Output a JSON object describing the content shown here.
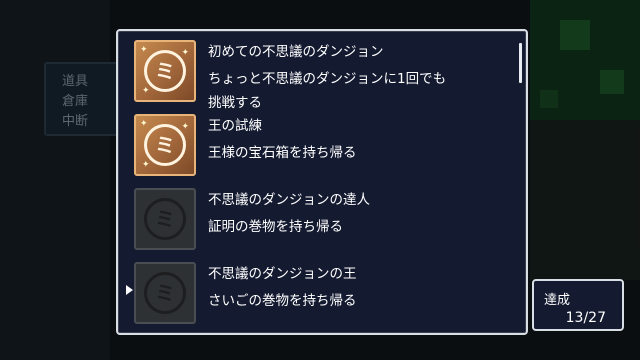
{
  "side_menu": {
    "items": [
      "道具",
      "倉庫",
      "中断"
    ]
  },
  "achievements": [
    {
      "title": "初めての不思議のダンジョン",
      "desc": "ちょっと不思議のダンジョンに1回でも挑戦する",
      "unlocked": true,
      "icon": "gold-medal-icon"
    },
    {
      "title": "王の試練",
      "desc": "王様の宝石箱を持ち帰る",
      "unlocked": true,
      "icon": "gold-medal-icon"
    },
    {
      "title": "不思議のダンジョンの達人",
      "desc": "証明の巻物を持ち帰る",
      "unlocked": false,
      "icon": "locked-medal-icon"
    },
    {
      "title": "不思議のダンジョンの王",
      "desc": "さいごの巻物を持ち帰る",
      "unlocked": false,
      "icon": "locked-medal-icon"
    }
  ],
  "counter": {
    "label": "達成",
    "value": "13/27"
  },
  "colors": {
    "window_bg": "#141a30",
    "window_border": "#d9dde4",
    "medal_gold": "#a1663a",
    "medal_locked": "#2e3134"
  }
}
